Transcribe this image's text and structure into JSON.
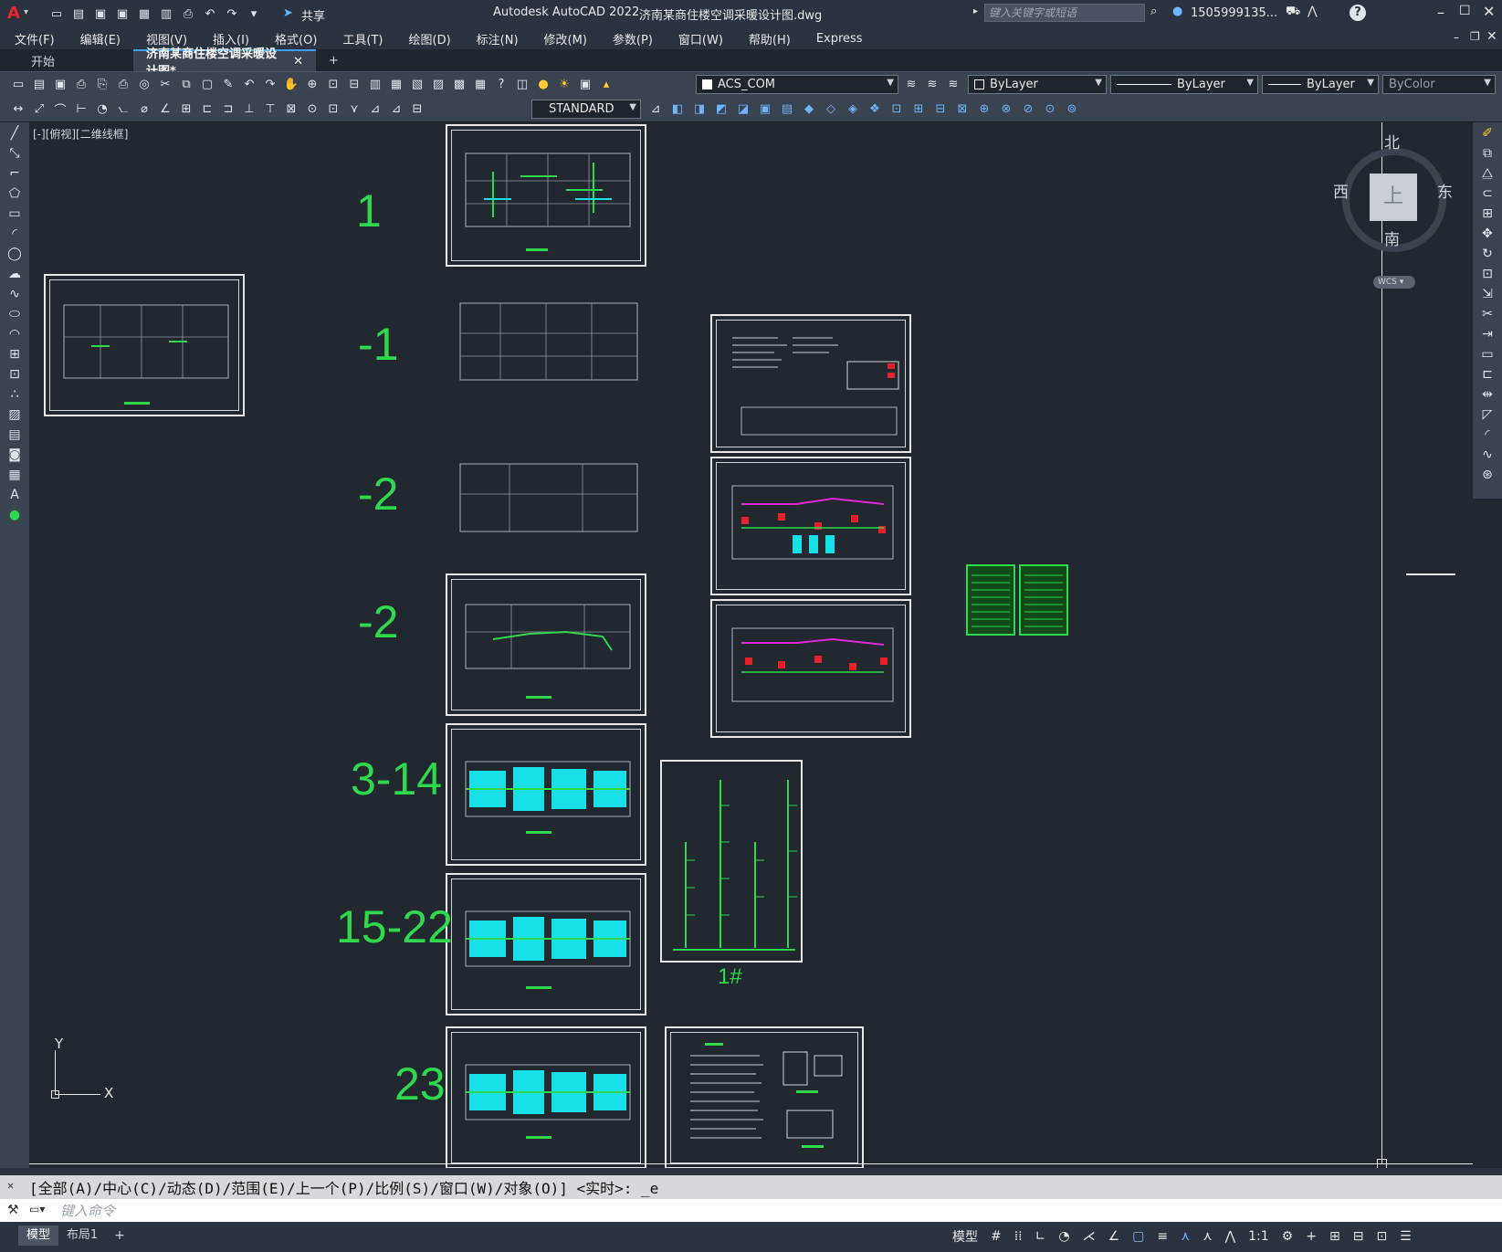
{
  "titlebar": {
    "app_logo": "A",
    "share_label": "共享",
    "title": "Autodesk AutoCAD 2022",
    "filename": "济南某商住楼空调采暖设计图.dwg",
    "search_placeholder": "键入关键字或短语",
    "user": "1505999135...",
    "help": "?"
  },
  "menu": [
    "文件(F)",
    "编辑(E)",
    "视图(V)",
    "插入(I)",
    "格式(O)",
    "工具(T)",
    "绘图(D)",
    "标注(N)",
    "修改(M)",
    "参数(P)",
    "窗口(W)",
    "帮助(H)",
    "Express"
  ],
  "tabs": {
    "start": "开始",
    "doc": "济南某商住楼空调采暖设计图*",
    "add": "+"
  },
  "toolbar": {
    "layer_name": "ACS_COM",
    "color": "ByLayer",
    "linetype": "ByLayer",
    "lineweight": "ByLayer",
    "plotstyle": "ByColor",
    "textstyle": "STANDARD"
  },
  "viewport": {
    "label": "[-][俯视][二维线框]",
    "compass": {
      "north": "北",
      "south": "南",
      "east": "东",
      "west": "西",
      "top": "上",
      "wcs": "WCS"
    },
    "ucs": {
      "x": "X",
      "y": "Y"
    }
  },
  "floor_labels": [
    "1",
    "-1",
    "-2",
    "-2",
    "3-14",
    "15-22",
    "23"
  ],
  "riser_label": "1#",
  "command": {
    "history": "[全部(A)/中心(C)/动态(D)/范围(E)/上一个(P)/比例(S)/窗口(W)/对象(O)] <实时>: _e",
    "placeholder": "键入命令"
  },
  "layout_tabs": {
    "model": "模型",
    "layout1": "布局1",
    "add": "+"
  },
  "status": {
    "model_label": "模型",
    "scale": "1:1"
  },
  "colors": {
    "accent": "#2fd84c",
    "cyan": "#19e0e6",
    "magenta": "#e02ad9",
    "red": "#e8202a",
    "bg": "#212830"
  }
}
